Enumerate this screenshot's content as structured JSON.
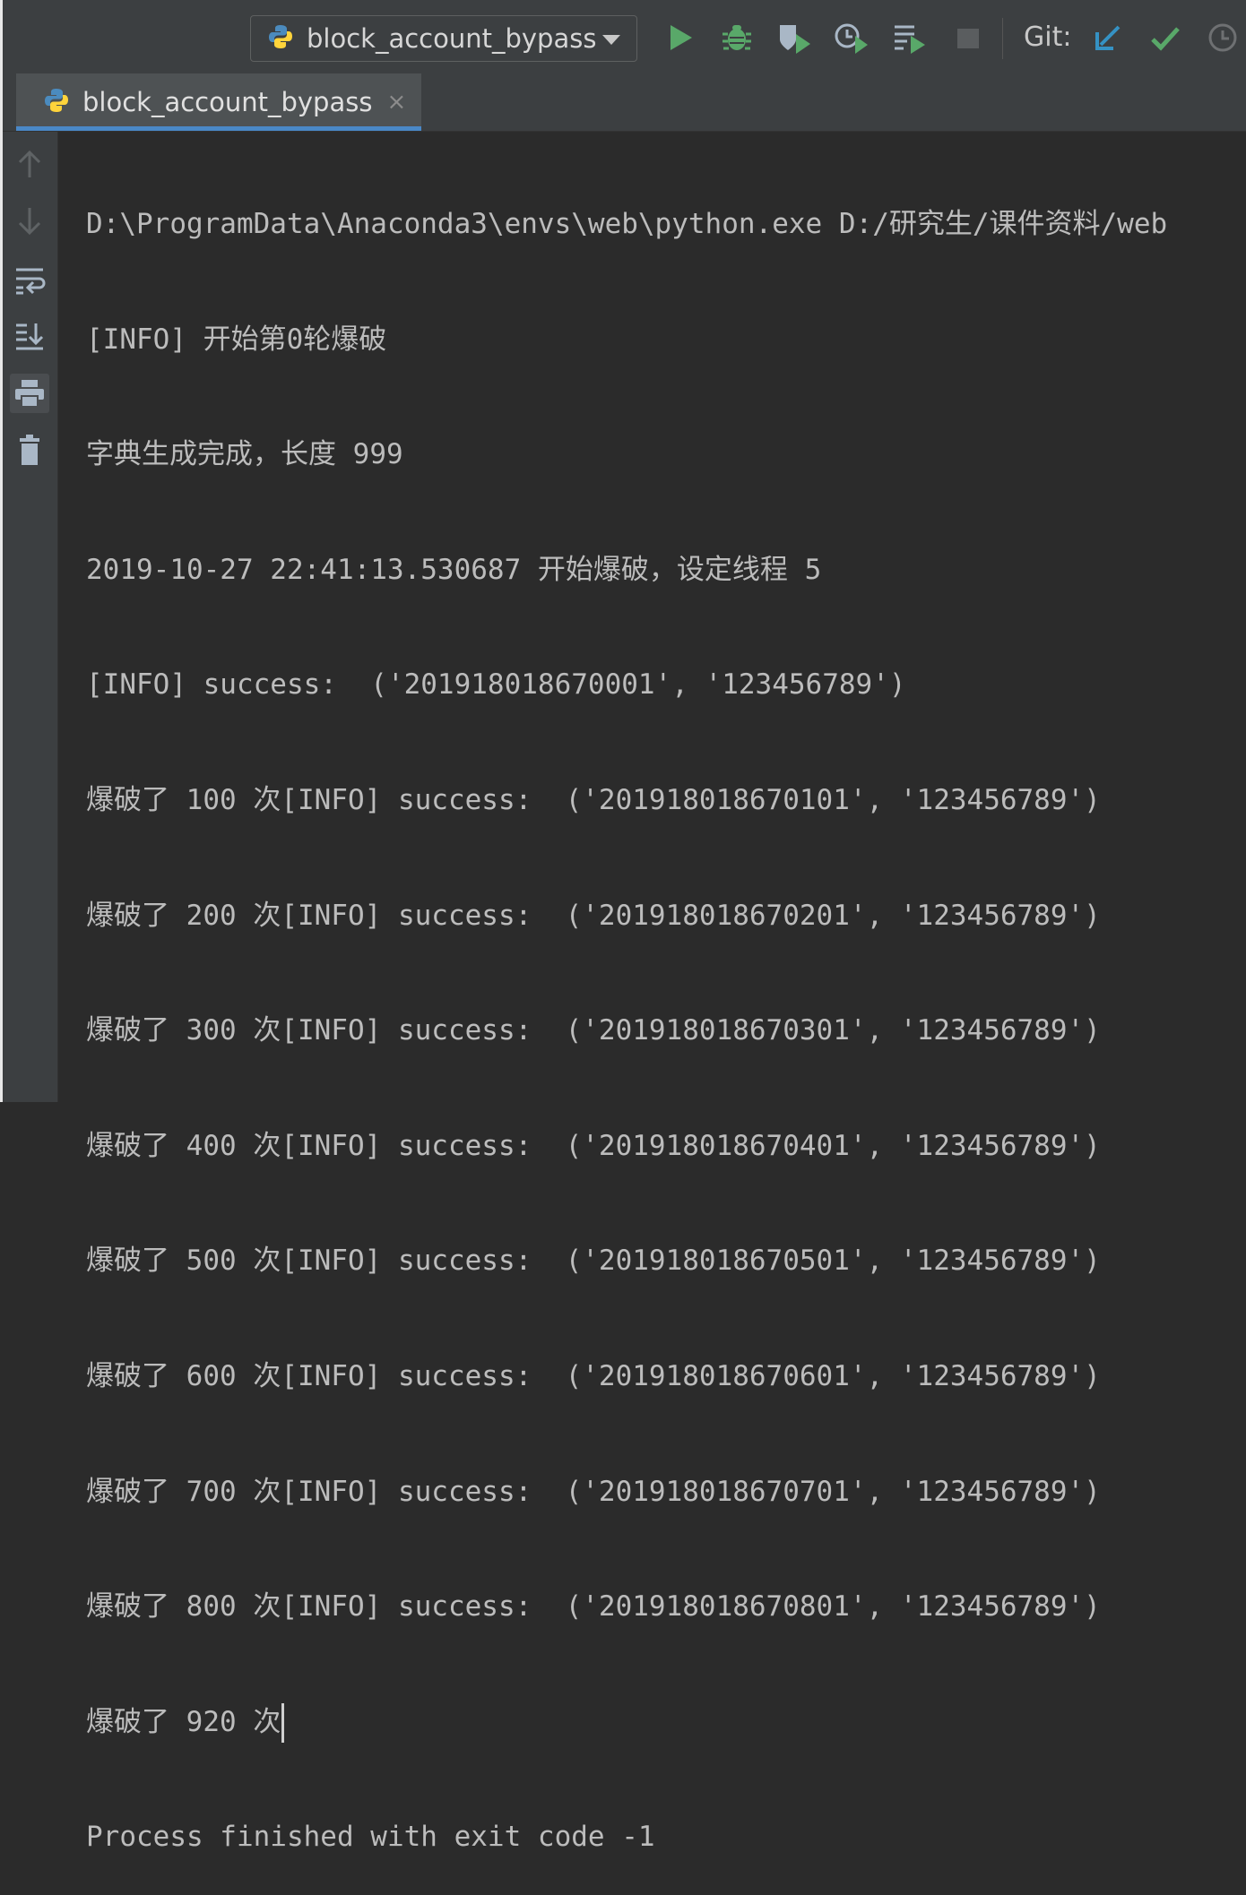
{
  "toolbar": {
    "run_config_label": "block_account_bypass",
    "git_label": "Git:"
  },
  "tab": {
    "label": "block_account_bypass",
    "close": "×"
  },
  "console": {
    "lines": [
      "D:\\ProgramData\\Anaconda3\\envs\\web\\python.exe D:/研究生/课件资料/web",
      "[INFO] 开始第0轮爆破",
      "字典生成完成，长度 999",
      "2019-10-27 22:41:13.530687 开始爆破，设定线程 5",
      "[INFO] success:  ('201918018670001', '123456789')",
      "爆破了 100 次[INFO] success:  ('201918018670101', '123456789')",
      "爆破了 200 次[INFO] success:  ('201918018670201', '123456789')",
      "爆破了 300 次[INFO] success:  ('201918018670301', '123456789')",
      "爆破了 400 次[INFO] success:  ('201918018670401', '123456789')",
      "爆破了 500 次[INFO] success:  ('201918018670501', '123456789')",
      "爆破了 600 次[INFO] success:  ('201918018670601', '123456789')",
      "爆破了 700 次[INFO] success:  ('201918018670701', '123456789')",
      "爆破了 800 次[INFO] success:  ('201918018670801', '123456789')",
      "爆破了 920 次",
      "Process finished with exit code -1"
    ]
  },
  "colors": {
    "run": "#59a869",
    "debug": "#59a869",
    "git_update": "#3592c4",
    "git_commit": "#59a869",
    "tab_underline": "#4a88c7"
  }
}
